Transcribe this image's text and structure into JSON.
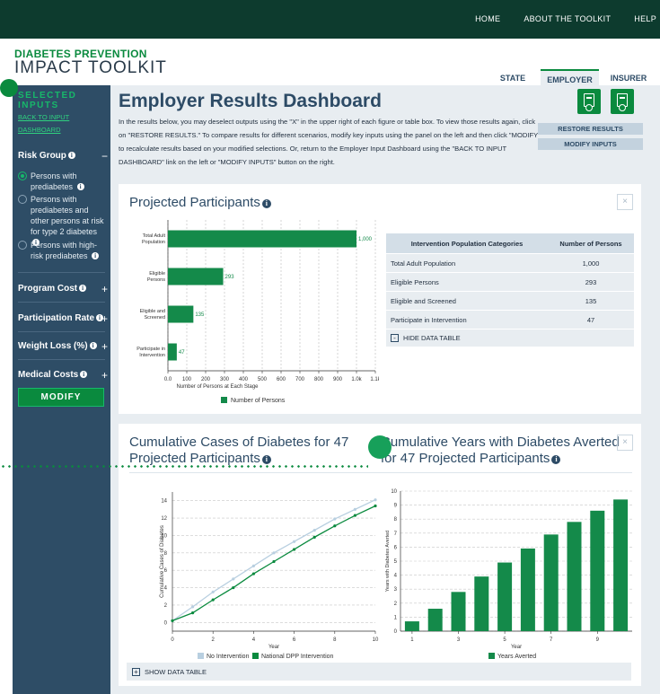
{
  "topnav": {
    "links": [
      "HOME",
      "ABOUT THE TOOLKIT",
      "HELP"
    ]
  },
  "brand": {
    "line1": "DIABETES PREVENTION",
    "line2": "IMPACT TOOLKIT"
  },
  "tabs": [
    {
      "label": "STATE"
    },
    {
      "label": "EMPLOYER",
      "active": true
    },
    {
      "label": "INSURER"
    }
  ],
  "sidebar": {
    "header": "SELECTED INPUTS",
    "back_link": "BACK TO INPUT DASHBOARD",
    "risk_group": {
      "label": "Risk Group",
      "toggle": "−",
      "options": [
        {
          "label": "Persons with prediabetes",
          "selected": true
        },
        {
          "label": "Persons with prediabetes and other persons at risk for type 2 diabetes",
          "selected": false
        },
        {
          "label": "Persons with high-risk prediabetes",
          "selected": false
        }
      ]
    },
    "sections": [
      {
        "label": "Program Cost",
        "toggle": "+"
      },
      {
        "label": "Participation Rate",
        "toggle": "+"
      },
      {
        "label": "Weight Loss (%)",
        "toggle": "+"
      },
      {
        "label": "Medical Costs",
        "toggle": "+"
      }
    ],
    "modify_label": "MODIFY"
  },
  "main": {
    "title": "Employer Results Dashboard",
    "intro": "In the results below, you may deselect outputs using the \"X\" in the upper right of each figure or table box. To view those results again, click on \"RESTORE RESULTS.\" To compare results for different scenarios, modify key inputs using the panel on the left and then click \"MODIFY\" to recalculate results based on your modified selections. Or, return to the Employer Input Dashboard using the \"BACK TO INPUT DASHBOARD\" link on the left or \"MODIFY INPUTS\" button on the right.",
    "restore_label": "RESTORE RESULTS",
    "modify_inputs_label": "MODIFY INPUTS",
    "download_icons": [
      "download-xls-icon",
      "download-pdf-icon"
    ]
  },
  "card1": {
    "title": "Projected Participants",
    "close": "×",
    "table": {
      "headers": [
        "Intervention Population Categories",
        "Number of Persons"
      ],
      "rows": [
        [
          "Total Adult Population",
          "1,000"
        ],
        [
          "Eligible Persons",
          "293"
        ],
        [
          "Eligible and Screened",
          "135"
        ],
        [
          "Participate in Intervention",
          "47"
        ]
      ],
      "hide_toggle": "-",
      "hide_label": "HIDE DATA TABLE"
    }
  },
  "card2": {
    "title1": "Cumulative Cases of Diabetes for 47 Projected Participants",
    "title2": "Cumulative Years with Diabetes Averted for 47 Projected Participants",
    "close": "×",
    "show_toggle": "+",
    "show_label": "SHOW DATA TABLE"
  },
  "chart_data": [
    {
      "type": "bar",
      "orientation": "horizontal",
      "categories": [
        "Total Adult Population",
        "Eligible Persons",
        "Eligible and Screened",
        "Participate in Intervention"
      ],
      "values": [
        1000,
        293,
        135,
        47
      ],
      "data_labels": [
        "1,000",
        "293",
        "135",
        "47"
      ],
      "xlabel": "Number of Persons at Each Stage",
      "xticks": [
        "0.0",
        "100",
        "200",
        "300",
        "400",
        "500",
        "600",
        "700",
        "800",
        "900",
        "1.0k",
        "1.1k"
      ],
      "xlim": [
        0,
        1100
      ],
      "legend": [
        "Number of Persons"
      ],
      "color": "#148a4a"
    },
    {
      "type": "line",
      "x": [
        0,
        1,
        2,
        3,
        4,
        5,
        6,
        7,
        8,
        9,
        10
      ],
      "series": [
        {
          "name": "No Intervention",
          "values": [
            0.2,
            1.8,
            3.5,
            5.0,
            6.5,
            8.0,
            9.3,
            10.6,
            11.9,
            13.0,
            14.1
          ],
          "color": "#b8cfe0"
        },
        {
          "name": "National DPP Intervention",
          "values": [
            0.2,
            1.1,
            2.6,
            4.0,
            5.6,
            7.0,
            8.4,
            9.8,
            11.1,
            12.3,
            13.4
          ],
          "color": "#0a8a3e"
        }
      ],
      "xlabel": "Year",
      "ylabel": "Cumulative Cases of Diabetes",
      "xlim": [
        0,
        10
      ],
      "ylim": [
        -1,
        15
      ],
      "xticks": [
        0,
        2,
        4,
        6,
        8,
        10
      ],
      "yticks": [
        0,
        2,
        4,
        6,
        8,
        10,
        12,
        14
      ],
      "legend": "bottom"
    },
    {
      "type": "bar",
      "categories": [
        1,
        2,
        3,
        4,
        5,
        6,
        7,
        8,
        9,
        10
      ],
      "xticks": [
        "1",
        "3",
        "5",
        "7",
        "9"
      ],
      "values": [
        0.7,
        1.6,
        2.8,
        3.9,
        4.9,
        5.9,
        6.9,
        7.8,
        8.6,
        9.4
      ],
      "series_name": "Years Averted",
      "xlabel": "Year",
      "ylabel": "Years with Diabetes Averted",
      "ylim": [
        0,
        10
      ],
      "yticks": [
        0,
        1,
        2,
        3,
        4,
        5,
        6,
        7,
        8,
        9,
        10
      ],
      "legend": "bottom",
      "color": "#148a4a"
    }
  ]
}
